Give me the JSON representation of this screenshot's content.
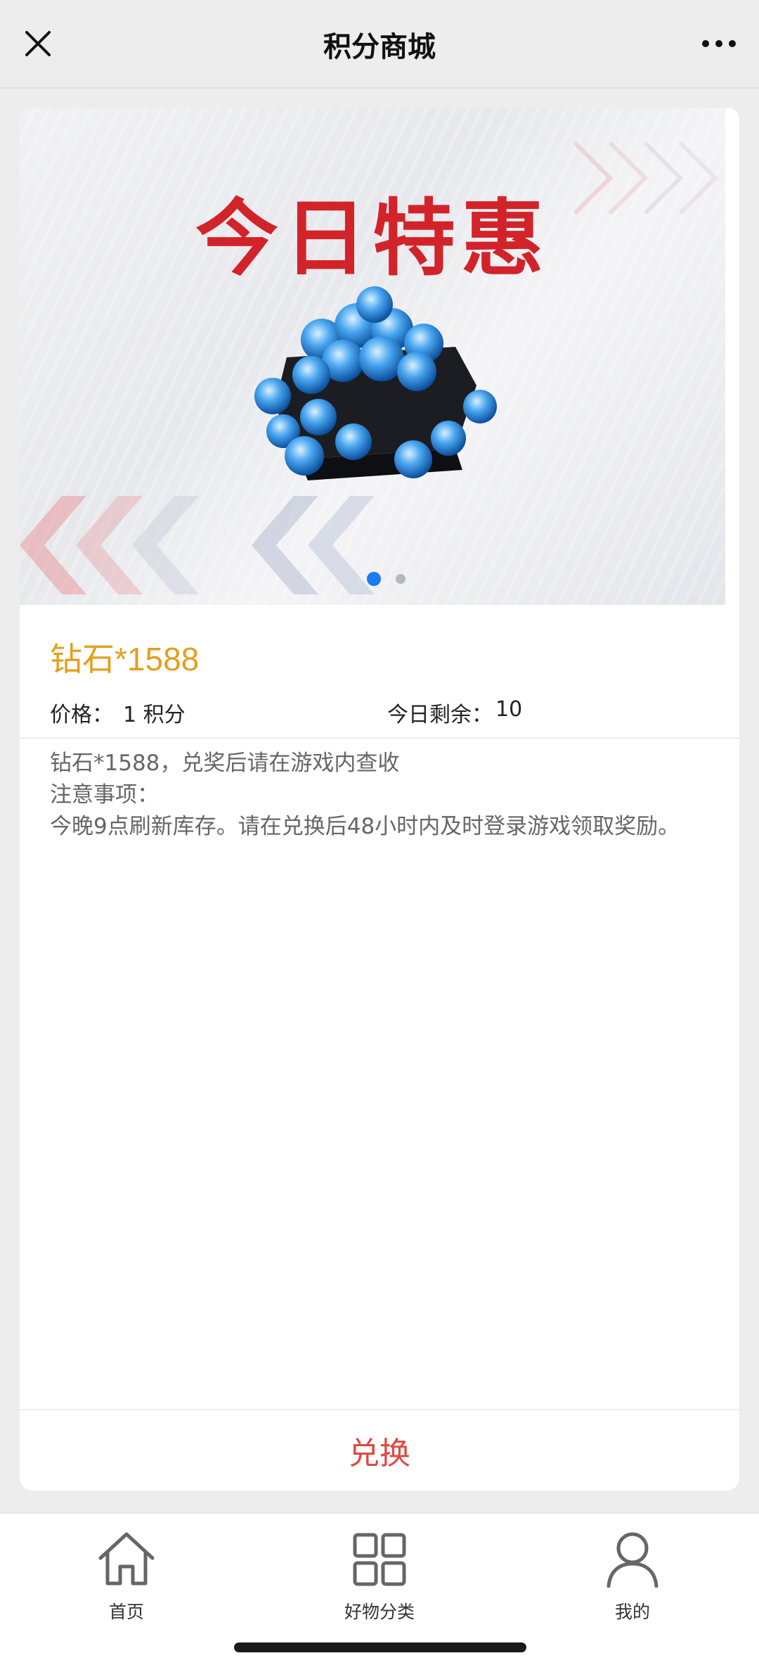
{
  "header": {
    "title": "积分商城",
    "close_icon": "close-icon",
    "more_icon": "more-icon"
  },
  "banner": {
    "headline": "今日特惠",
    "slides_total": 2,
    "active_slide": 1,
    "colors": {
      "headline": "#d3232a",
      "active_dot": "#1a7cf0"
    }
  },
  "product": {
    "name": "钻石*1588",
    "price_label": "价格：",
    "price_value": "1 积分",
    "remain_label": "今日剩余：",
    "remain_value": "10",
    "description": {
      "line1": "钻石*1588，兑奖后请在游戏内查收",
      "line2": "注意事项：",
      "line3": "今晚9点刷新库存。请在兑换后48小时内及时登录游戏领取奖励。"
    }
  },
  "actions": {
    "exchange_label": "兑换"
  },
  "tabbar": {
    "items": [
      {
        "label": "首页",
        "icon": "home-icon"
      },
      {
        "label": "好物分类",
        "icon": "grid-icon"
      },
      {
        "label": "我的",
        "icon": "user-icon"
      }
    ]
  }
}
